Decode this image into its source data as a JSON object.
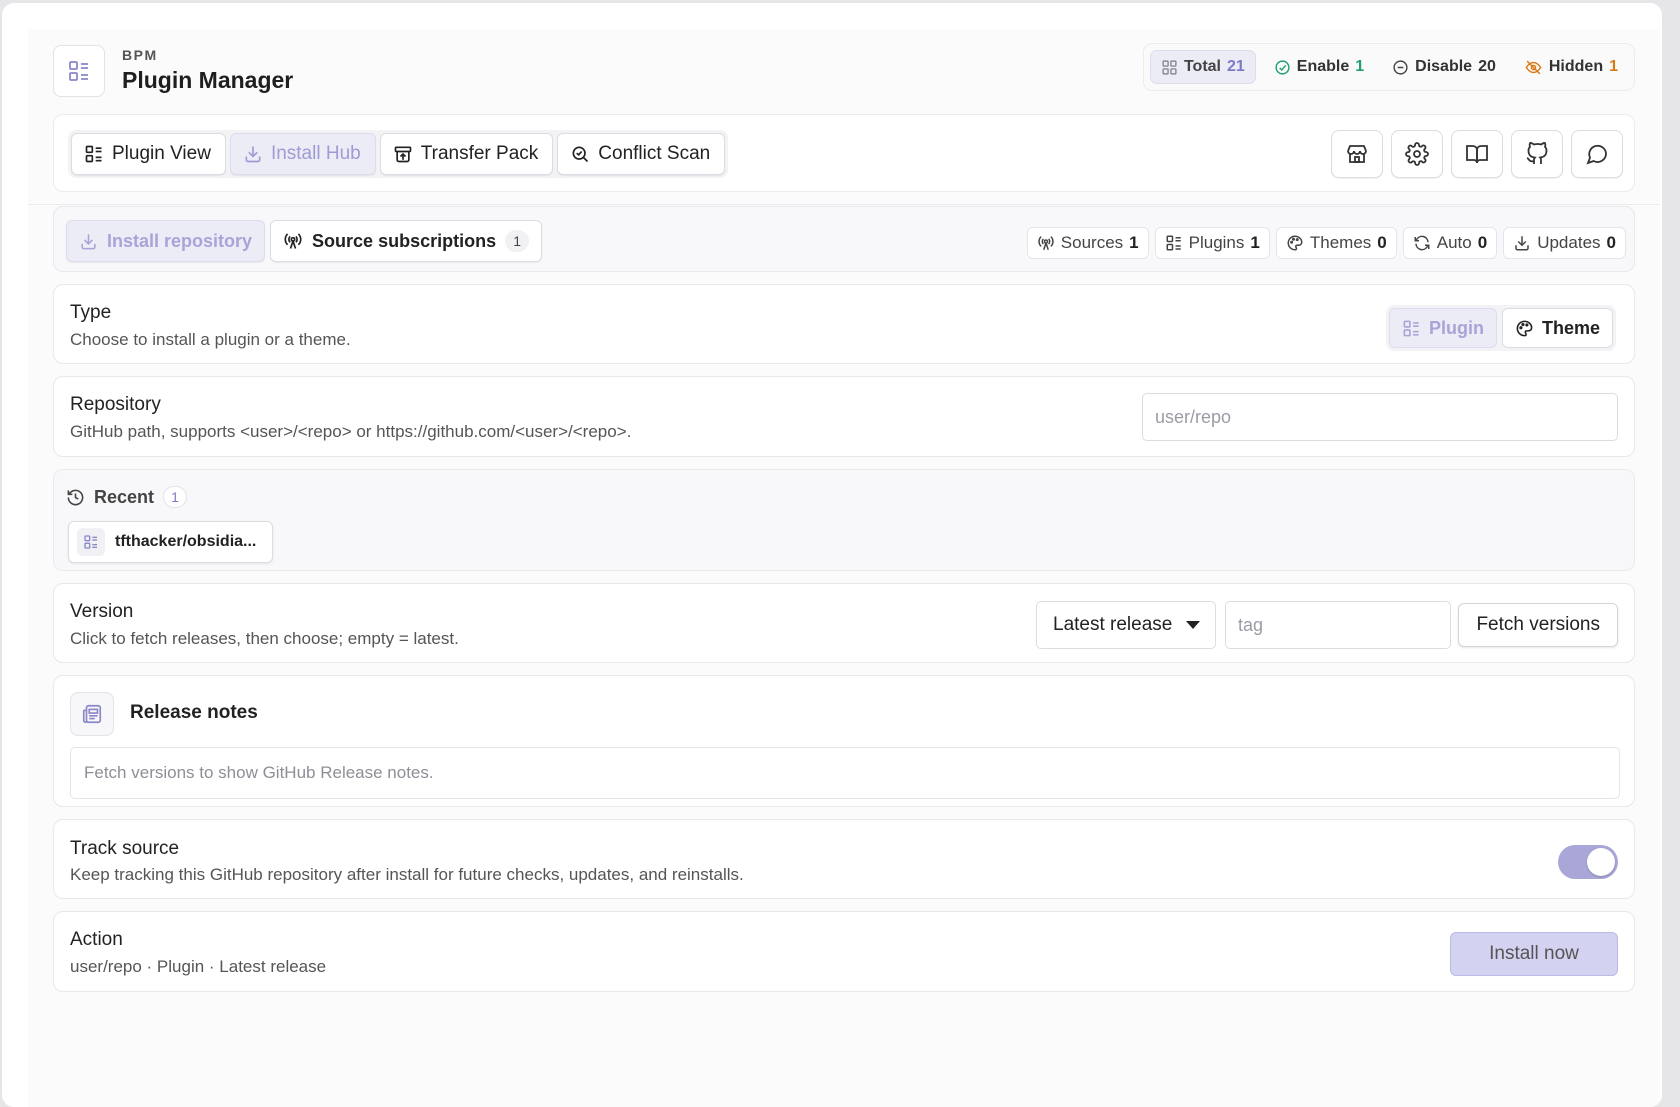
{
  "header": {
    "brand": "BPM",
    "title": "Plugin Manager",
    "stats": [
      {
        "label": "Total",
        "count": "21"
      },
      {
        "label": "Enable",
        "count": "1"
      },
      {
        "label": "Disable",
        "count": "20"
      },
      {
        "label": "Hidden",
        "count": "1"
      }
    ]
  },
  "toolbar": {
    "tabs": [
      {
        "label": "Plugin View"
      },
      {
        "label": "Install Hub"
      },
      {
        "label": "Transfer Pack"
      },
      {
        "label": "Conflict Scan"
      }
    ],
    "active_tab": "Install Hub"
  },
  "install": {
    "sub_tabs": [
      {
        "label": "Install repository"
      },
      {
        "label": "Source subscriptions",
        "badge": "1"
      }
    ],
    "source_stats": [
      {
        "label": "Sources",
        "count": "1"
      },
      {
        "label": "Plugins",
        "count": "1"
      },
      {
        "label": "Themes",
        "count": "0"
      },
      {
        "label": "Auto",
        "count": "0"
      },
      {
        "label": "Updates",
        "count": "0"
      }
    ],
    "type": {
      "label": "Type",
      "desc": "Choose to install a plugin or a theme.",
      "options": [
        "Plugin",
        "Theme"
      ],
      "selected": "Plugin"
    },
    "repository": {
      "label": "Repository",
      "desc": "GitHub path, supports <user>/<repo> or https://github.com/<user>/<repo>.",
      "placeholder": "user/repo",
      "value": ""
    },
    "recent": {
      "label": "Recent",
      "count": "1",
      "items": [
        "tfthacker/obsidia..."
      ]
    },
    "version": {
      "label": "Version",
      "desc": "Click to fetch releases, then choose; empty = latest.",
      "selected": "Latest release",
      "tag_placeholder": "tag",
      "fetch_label": "Fetch versions"
    },
    "release_notes": {
      "title": "Release notes",
      "placeholder": "Fetch versions to show GitHub Release notes."
    },
    "track": {
      "label": "Track source",
      "desc": "Keep tracking this GitHub repository after install for future checks, updates, and reinstalls.",
      "enabled": true
    },
    "action": {
      "label": "Action",
      "summary": "user/repo · Plugin · Latest release",
      "button": "Install now"
    }
  },
  "colors": {
    "accent": "#a9a7d8",
    "enable": "#22a06b",
    "hidden": "#d87a14"
  }
}
